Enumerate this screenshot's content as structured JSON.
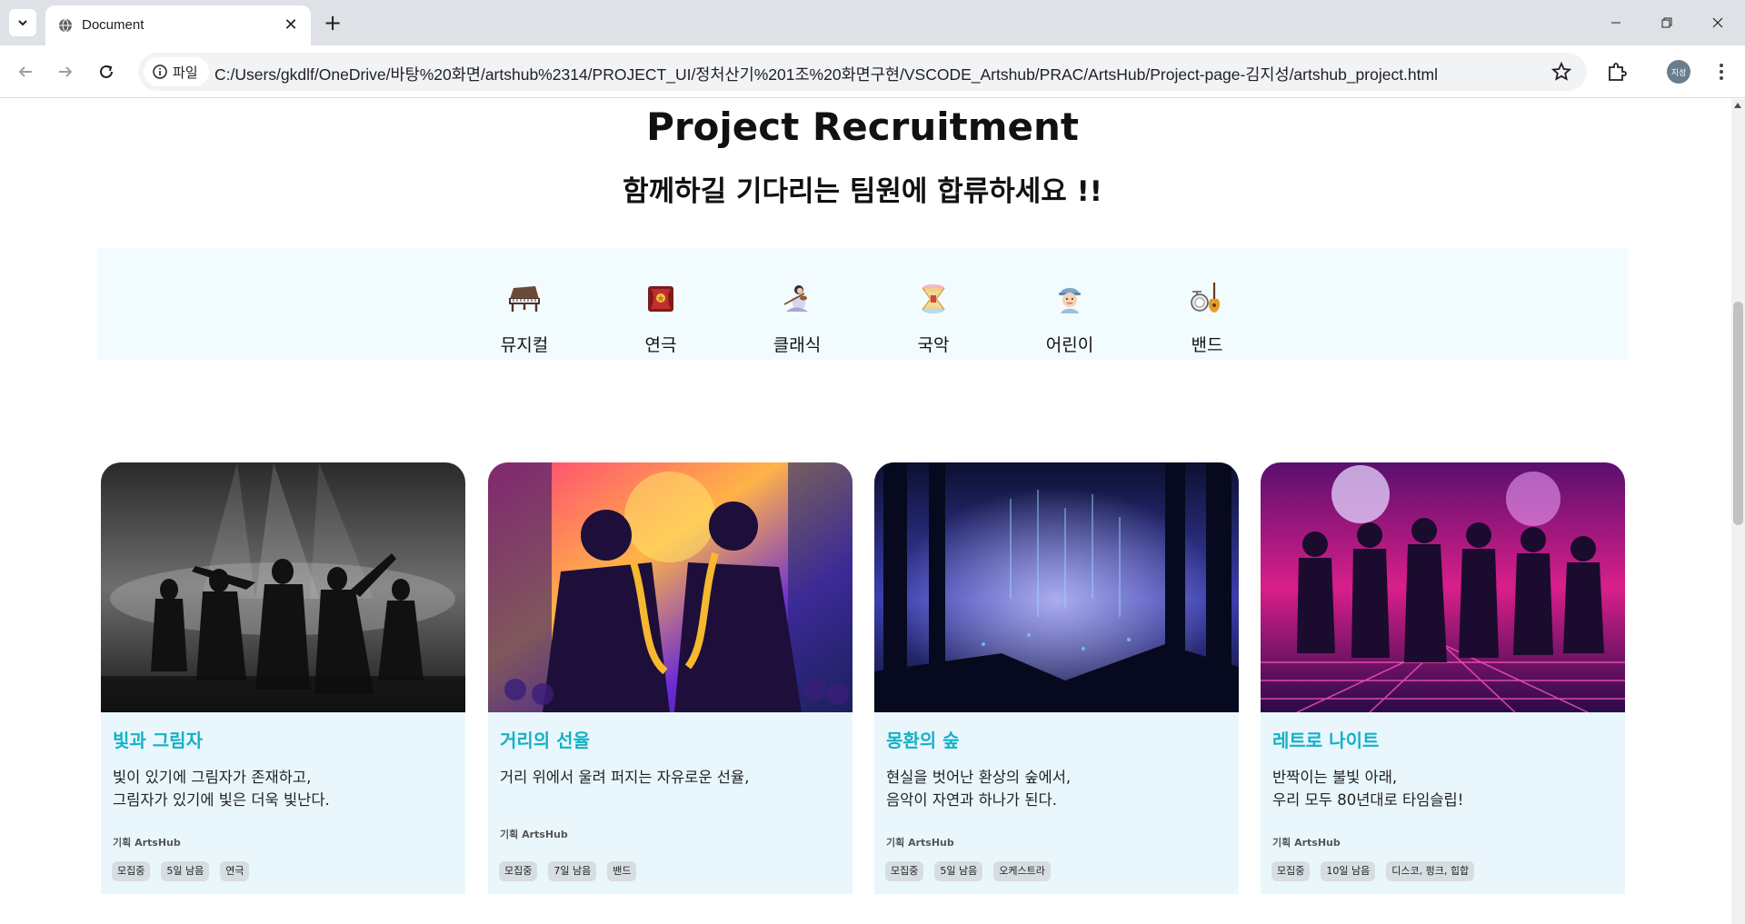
{
  "browser": {
    "tab_title": "Document",
    "url_chip": "파일",
    "url": "C:/Users/gkdlf/OneDrive/바탕%20화면/artshub%2314/PROJECT_UI/정처산기%201조%20화면구현/VSCODE_Artshub/PRAC/ArtsHub/Project-page-김지성/artshub_project.html",
    "profile_label": "지성"
  },
  "page": {
    "title": "Project Recruitment",
    "subtitle": "함께하길 기다리는 팀원에 합류하세요 !!"
  },
  "categories": [
    {
      "label": "뮤지컬",
      "icon": "piano-icon"
    },
    {
      "label": "연극",
      "icon": "theater-icon"
    },
    {
      "label": "클래식",
      "icon": "violinist-icon"
    },
    {
      "label": "국악",
      "icon": "janggu-drum-icon"
    },
    {
      "label": "어린이",
      "icon": "child-icon"
    },
    {
      "label": "밴드",
      "icon": "guitar-drum-icon"
    }
  ],
  "projects": [
    {
      "title": "빛과 그림자",
      "desc_line1": "빛이 있기에 그림자가 존재하고,",
      "desc_line2": "그림자가 있기에 빛은 더욱 빛난다.",
      "credit": "기획 ArtsHub",
      "tags": [
        "모집중",
        "5일 남음",
        "연극"
      ]
    },
    {
      "title": "거리의 선율",
      "desc_line1": "거리 위에서 울려 퍼지는 자유로운 선율,",
      "desc_line2": "",
      "credit": "기획 ArtsHub",
      "tags": [
        "모집중",
        "7일 남음",
        "밴드"
      ]
    },
    {
      "title": "몽환의 숲",
      "desc_line1": "현실을 벗어난 환상의 숲에서,",
      "desc_line2": "음악이 자연과 하나가 된다.",
      "credit": "기획 ArtsHub",
      "tags": [
        "모집중",
        "5일 남음",
        "오케스트라"
      ]
    },
    {
      "title": "레트로 나이트",
      "desc_line1": "반짝이는 불빛 아래,",
      "desc_line2": "우리 모두 80년대로 타임슬립!",
      "credit": "기획 ArtsHub",
      "tags": [
        "모집중",
        "10일 남음",
        "디스코, 펑크, 힙합"
      ]
    }
  ],
  "colors": {
    "accent": "#14b1c6",
    "card_bg": "#e9f7fd",
    "band_bg": "#f2fbfe",
    "tag_bg": "#d6dee2"
  }
}
